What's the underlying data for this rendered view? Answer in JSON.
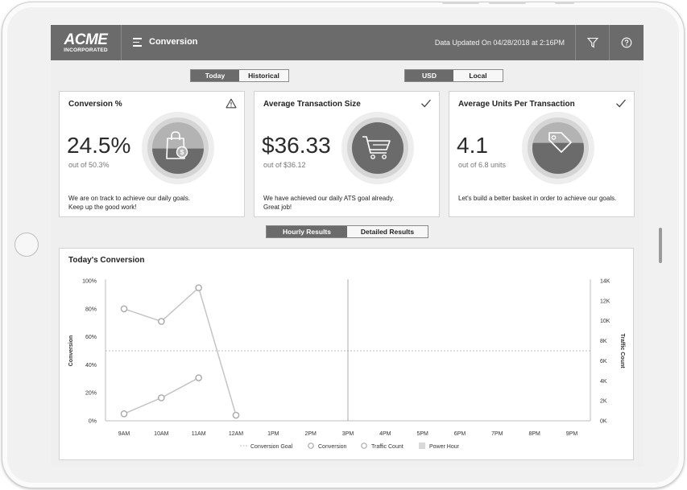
{
  "header": {
    "brand_main": "ACME",
    "brand_sub": "INCORPORATED",
    "title": "Conversion",
    "updated": "Data Updated On 04/28/2018 at 2:16PM"
  },
  "period_toggle": {
    "options": [
      "Today",
      "Historical"
    ],
    "selected": "Today"
  },
  "currency_toggle": {
    "options": [
      "USD",
      "Local"
    ],
    "selected": "USD"
  },
  "cards": [
    {
      "title": "Conversion %",
      "status_icon": "warning-icon",
      "value": "24.5%",
      "sub": "out of 50.3%",
      "message_line1": "We are on track to achieve our daily goals.",
      "message_line2": "Keep up the good work!",
      "gauge_icon": "shopping-bag-icon",
      "gauge_fill": 0.49
    },
    {
      "title": "Average Transaction Size",
      "status_icon": "check-icon",
      "value": "$36.33",
      "sub": "out of $36.12",
      "message_line1": "We have achieved our daily ATS goal already.",
      "message_line2": "Great job!",
      "gauge_icon": "shopping-cart-icon",
      "gauge_fill": 1.0
    },
    {
      "title": "Average Units Per Transaction",
      "status_icon": "check-icon",
      "value": "4.1",
      "sub": "out of 6.8 units",
      "message_line1": "Let's build a better basket in order to achieve our goals.",
      "message_line2": "",
      "gauge_icon": "price-tag-icon",
      "gauge_fill": 0.6
    }
  ],
  "results_toggle": {
    "options": [
      "Hourly Results",
      "Detailed Results"
    ],
    "selected": "Hourly Results"
  },
  "chart_data": {
    "type": "line",
    "title": "Today's Conversion",
    "ylabel": "Conversion",
    "y2label": "Traffic Count",
    "x": [
      "9AM",
      "10AM",
      "11AM",
      "12AM",
      "1PM",
      "2PM",
      "3PM",
      "4PM",
      "5PM",
      "6PM",
      "7PM",
      "8PM",
      "9PM"
    ],
    "y_ticks": [
      "0%",
      "20%",
      "40%",
      "60%",
      "80%",
      "100%"
    ],
    "y2_ticks": [
      "0K",
      "2K",
      "4K",
      "6K",
      "8K",
      "10K",
      "12K",
      "14K"
    ],
    "ylim": [
      0,
      100
    ],
    "y2lim": [
      0,
      14000
    ],
    "conversion_goal": 50,
    "current_hour_marker": "3PM",
    "series": [
      {
        "name": "Conversion",
        "values": [
          80,
          71,
          95,
          4
        ]
      },
      {
        "name": "Traffic Count",
        "axis": "right",
        "values": [
          700,
          2300,
          4300
        ]
      }
    ],
    "legend": [
      "Conversion Goal",
      "Conversion",
      "Traffic Count",
      "Power Hour"
    ],
    "legend_position": "bottom-center",
    "colors": {
      "line": "#c4c4c4",
      "goal": "#a8a8a8",
      "power_hour": "#d9d9d9",
      "marker": "#ababab"
    }
  }
}
